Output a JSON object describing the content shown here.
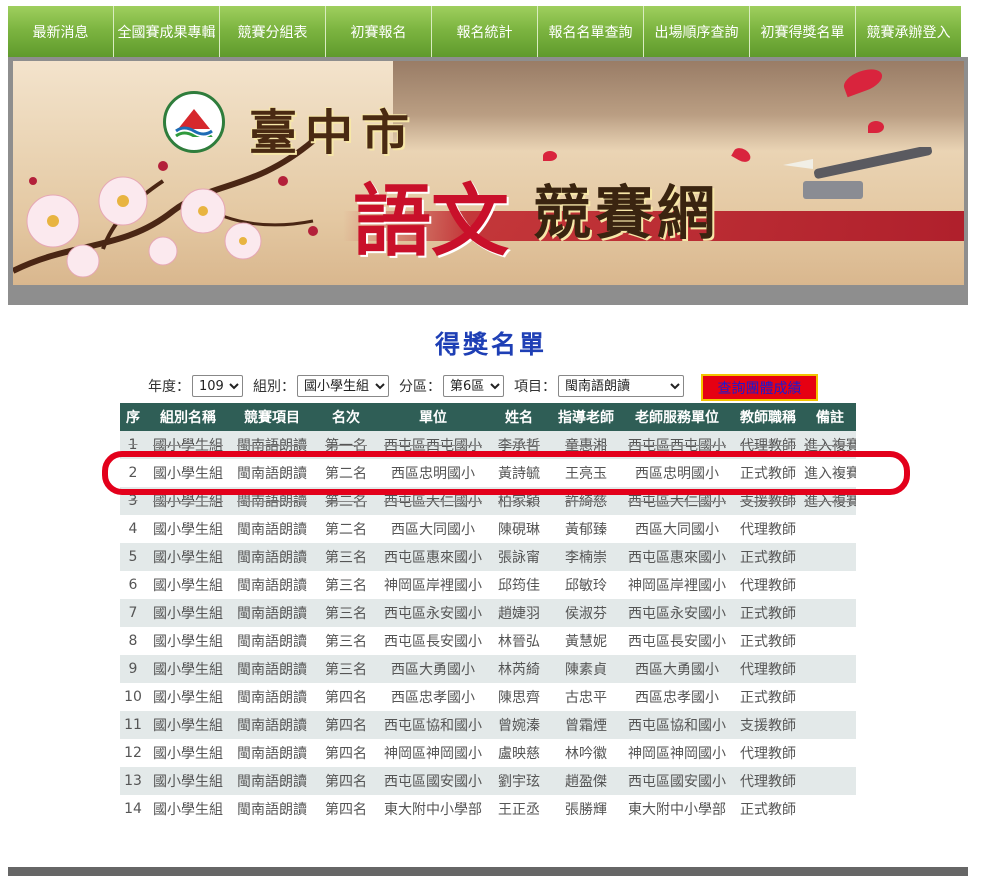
{
  "nav": {
    "items": [
      "最新消息",
      "全國賽成果專輯",
      "競賽分組表",
      "初賽報名",
      "報名統計",
      "報名名單查詢",
      "出場順序查詢",
      "初賽得獎名單",
      "競賽承辦登入"
    ]
  },
  "banner": {
    "city": "臺中市",
    "title_a": "語文",
    "title_b": "競賽網"
  },
  "page": {
    "title": "得獎名單"
  },
  "filters": {
    "year_label": "年度：",
    "year_value": "109",
    "group_label": "組別：",
    "group_value": "國小學生組",
    "district_label": "分區：",
    "district_value": "第6區",
    "item_label": "項目：",
    "item_value": "閩南語朗讀",
    "query_button": "查詢團體成績"
  },
  "table": {
    "headers": [
      "序",
      "組別名稱",
      "競賽項目",
      "名次",
      "單位",
      "姓名",
      "指導老師",
      "老師服務單位",
      "教師職稱",
      "備註"
    ],
    "rows": [
      [
        "1",
        "國小學生組",
        "閩南語朗讀",
        "第一名",
        "西屯區西屯國小",
        "李承哲",
        "童惠湘",
        "西屯區西屯國小",
        "代理教師",
        "進入複賽"
      ],
      [
        "2",
        "國小學生組",
        "閩南語朗讀",
        "第二名",
        "西區忠明國小",
        "黃詩毓",
        "王亮玉",
        "西區忠明國小",
        "正式教師",
        "進入複賽"
      ],
      [
        "3",
        "國小學生組",
        "閩南語朗讀",
        "第二名",
        "西屯區大仁國小",
        "柏家穎",
        "許綺慈",
        "西屯區大仁國小",
        "支援教師",
        "進入複賽"
      ],
      [
        "4",
        "國小學生組",
        "閩南語朗讀",
        "第二名",
        "西區大同國小",
        "陳硯琳",
        "黃郁臻",
        "西區大同國小",
        "代理教師",
        ""
      ],
      [
        "5",
        "國小學生組",
        "閩南語朗讀",
        "第三名",
        "西屯區惠來國小",
        "張詠甯",
        "李楠崇",
        "西屯區惠來國小",
        "正式教師",
        ""
      ],
      [
        "6",
        "國小學生組",
        "閩南語朗讀",
        "第三名",
        "神岡區岸裡國小",
        "邱筠佳",
        "邱敏玲",
        "神岡區岸裡國小",
        "代理教師",
        ""
      ],
      [
        "7",
        "國小學生組",
        "閩南語朗讀",
        "第三名",
        "西屯區永安國小",
        "趙婕羽",
        "侯淑芬",
        "西屯區永安國小",
        "正式教師",
        ""
      ],
      [
        "8",
        "國小學生組",
        "閩南語朗讀",
        "第三名",
        "西屯區長安國小",
        "林晉弘",
        "黃慧妮",
        "西屯區長安國小",
        "正式教師",
        ""
      ],
      [
        "9",
        "國小學生組",
        "閩南語朗讀",
        "第三名",
        "西區大勇國小",
        "林芮綺",
        "陳素貞",
        "西區大勇國小",
        "代理教師",
        ""
      ],
      [
        "10",
        "國小學生組",
        "閩南語朗讀",
        "第四名",
        "西區忠孝國小",
        "陳思齊",
        "古忠平",
        "西區忠孝國小",
        "正式教師",
        ""
      ],
      [
        "11",
        "國小學生組",
        "閩南語朗讀",
        "第四名",
        "西屯區協和國小",
        "曾婉溱",
        "曾霜煙",
        "西屯區協和國小",
        "支援教師",
        ""
      ],
      [
        "12",
        "國小學生組",
        "閩南語朗讀",
        "第四名",
        "神岡區神岡國小",
        "盧映慈",
        "林吟徽",
        "神岡區神岡國小",
        "代理教師",
        ""
      ],
      [
        "13",
        "國小學生組",
        "閩南語朗讀",
        "第四名",
        "西屯區國安國小",
        "劉宇玹",
        "趙盈傑",
        "西屯區國安國小",
        "代理教師",
        ""
      ],
      [
        "14",
        "國小學生組",
        "閩南語朗讀",
        "第四名",
        "東大附中小學部",
        "王正丞",
        "張勝輝",
        "東大附中小學部",
        "正式教師",
        ""
      ]
    ]
  },
  "colors": {
    "nav_green": "#7db541",
    "table_header": "#2f5e56",
    "row_alt": "#e3e9e9",
    "title_blue": "#1e3fb5",
    "highlight_red": "#e3001b"
  }
}
